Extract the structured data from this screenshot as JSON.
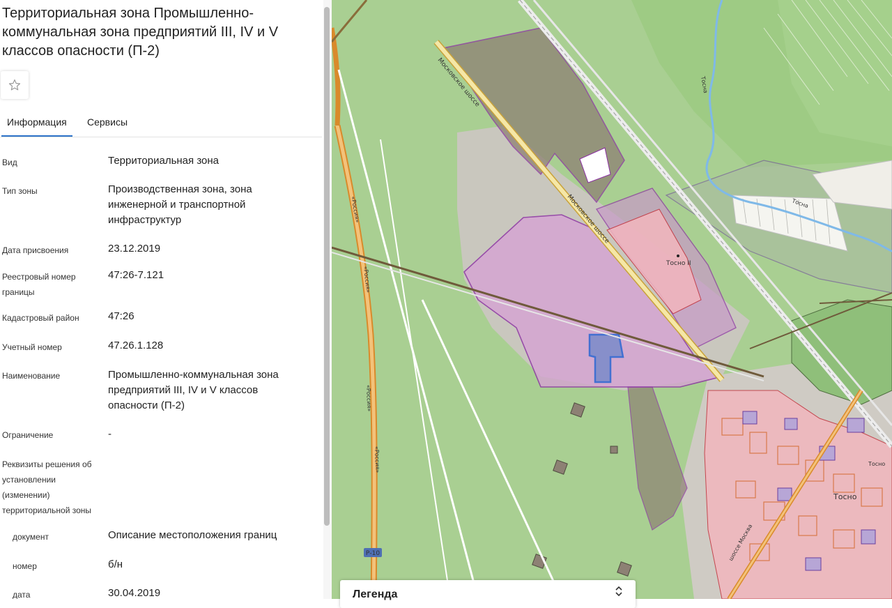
{
  "panel": {
    "title": "Территориальная зона Промышленно-коммунальная зона предприятий III, IV и V классов опасности (П-2)",
    "favorite_icon": "star-outline-icon",
    "tabs": [
      {
        "label": "Информация",
        "active": true
      },
      {
        "label": "Сервисы",
        "active": false
      }
    ],
    "fields": {
      "vid": {
        "label": "Вид",
        "value": "Территориальная зона"
      },
      "tip_zony": {
        "label": "Тип зоны",
        "value": "Производственная зона, зона инженерной и транспортной инфраструктур"
      },
      "data_prisvoeniya": {
        "label": "Дата присвоения",
        "value": "23.12.2019"
      },
      "reestr_nomer": {
        "label": "Реестровый номер границы",
        "value": "47:26-7.121"
      },
      "kadastr_rayon": {
        "label": "Кадастровый район",
        "value": "47:26"
      },
      "uchetny_nomer": {
        "label": "Учетный номер",
        "value": "47.26.1.128"
      },
      "naimenovanie": {
        "label": "Наименование",
        "value": "Промышленно-коммунальная зона предприятий III, IV и V классов опасности (П-2)"
      },
      "ogranichenie": {
        "label": "Ограничение",
        "value": "-"
      },
      "rekvizity": {
        "label": "Реквизиты решения об установлении (изменении) территориальной зоны"
      },
      "dokument": {
        "label": "документ",
        "value": "Описание местоположения границ"
      },
      "nomer": {
        "label": "номер",
        "value": "б/н"
      },
      "data": {
        "label": "дата",
        "value": "30.04.2019"
      }
    }
  },
  "map": {
    "labels": {
      "road_moscow_1": "Московское шоссе",
      "road_moscow_2": "Московское шоссе",
      "russia_1": "«Россия»",
      "russia_2": "«Россия»",
      "russia_3": "«Россия»",
      "russia_4": "«Россия»",
      "tosno2": "Тосно II",
      "tosno_station": "Тосно",
      "tosno_city": "Тосно",
      "river": "Тосна",
      "river2": "Тосна",
      "road_badge": "Р-10",
      "shosse_moskva": "шоссе Москва"
    },
    "colors": {
      "background": "#a9cf92",
      "industrial_zone": "#d6a3d4",
      "selected_parcel": "#1f62d2",
      "residential": "#f2b6bd",
      "highway": "#d98a2b"
    }
  },
  "legend": {
    "title": "Легенда",
    "toggle_icon": "chevron-updown-icon"
  }
}
